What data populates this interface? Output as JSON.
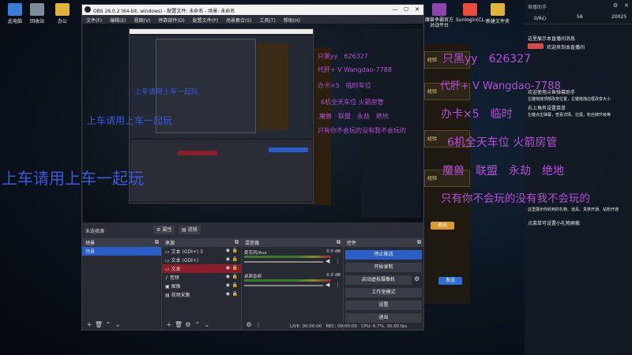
{
  "desktop_icons": [
    {
      "label": "此电脑",
      "color": "#3a7bd5"
    },
    {
      "label": "回收站",
      "color": "#7f8c99"
    },
    {
      "label": "办公",
      "color": "#e0b43a"
    }
  ],
  "desktop_icons_right": [
    {
      "label": "魔兽争霸官方对战平台",
      "color": "#8e44ad"
    },
    {
      "label": "Sunlogin(CL...",
      "color": "#e74c3c"
    },
    {
      "label": "新建文件夹",
      "color": "#e0b43a"
    }
  ],
  "window": {
    "title": "OBS 26.0.2 (64-bit, windows) - 配置文件: 未命名 - 场景: 未命名",
    "minimize": "—",
    "maximize": "☐",
    "close": "✕",
    "menu": [
      "文件(F)",
      "编辑(E)",
      "视图(V)",
      "停靠部件(D)",
      "配置文件(P)",
      "场景集合(S)",
      "工具(T)",
      "帮助(H)"
    ]
  },
  "toolbar": {
    "no_source": "未选择源",
    "properties": "属性",
    "filters": "滤镜"
  },
  "scenes": {
    "title": "场景",
    "items": [
      "场景"
    ]
  },
  "sources": {
    "title": "来源",
    "items": [
      {
        "label": "文本 (GDI+) 3",
        "icon": "▭",
        "selected": false
      },
      {
        "label": "文本 (GDI+)",
        "icon": "▭",
        "selected": false
      },
      {
        "label": "文本",
        "icon": "▭",
        "selected": true
      },
      {
        "label": "音频",
        "icon": "♪",
        "selected": false
      },
      {
        "label": "图像",
        "icon": "▣",
        "selected": false
      },
      {
        "label": "视频采集",
        "icon": "▤",
        "selected": false
      }
    ]
  },
  "mixer": {
    "title": "混音器",
    "channels": [
      {
        "name": "麦克风/Aux",
        "db": "0.0 dB"
      },
      {
        "name": "桌面音频",
        "db": "0.0 dB"
      }
    ]
  },
  "controls": {
    "title": "控件",
    "buttons": [
      "停止推流",
      "开始录制",
      "启动虚拟摄像机",
      "工作室模式",
      "设置",
      "退出"
    ]
  },
  "status": {
    "live": "LIVE: 00:00:00",
    "rec": "REC: 00:00:00",
    "cpu": "CPU: 6.7%, 30.00 fps"
  },
  "overlay": {
    "line1": "上车请用上车一起玩",
    "line2": "上车请用上车一起玩",
    "line3": "上车请用上车一起玩",
    "big": [
      {
        "text": "只黑yy　626327",
        "color": "#b54fd6"
      },
      {
        "text": "代肝+ V Wangdao-7788",
        "color": "#b54fd6"
      },
      {
        "text": "办卡×5　临时",
        "color": "#b54fd6"
      },
      {
        "text": "6机全天车位 火箭房管",
        "color": "#b54fd6"
      },
      {
        "text": "魔兽　联盟　永劫　绝地",
        "color": "#b54fd6"
      },
      {
        "text": "只有你不会玩的没有我不会玩的",
        "color": "#b54fd6"
      }
    ],
    "small": [
      {
        "text": "只黑yy　626327"
      },
      {
        "text": "代肝+ V Wangdao-7788"
      },
      {
        "text": "办卡×5　临时车位"
      },
      {
        "text": "6机全天车位 火箭房管"
      },
      {
        "text": "魔兽　联盟　永劫　绝地"
      },
      {
        "text": "只有你不会玩的没有我不会玩的"
      }
    ]
  },
  "livepanel": {
    "header": "摊播助手",
    "stats": [
      "0/6心",
      "56",
      "20025"
    ],
    "msgs": [
      "这里展示本直播间消息",
      "欢迎来到本直播间",
      "欢迎使用斗鱼弹幕助手",
      "左键拖拽顶部改变位置，左键拖拽边框改变大小",
      "右上角有设置菜单",
      "左键点击弹幕，查看详情、拉黑，粉丝牌升级等",
      "这里展示你收到的礼物、道具、贵族开通、钻粉开通",
      "点菜单可设置小礼物屏蔽"
    ],
    "brand_color": "#d94a4a"
  },
  "game": {
    "labels": [
      "经验",
      "经验",
      "经验",
      "经验"
    ],
    "btn1": "退出",
    "btn2": "发送"
  }
}
